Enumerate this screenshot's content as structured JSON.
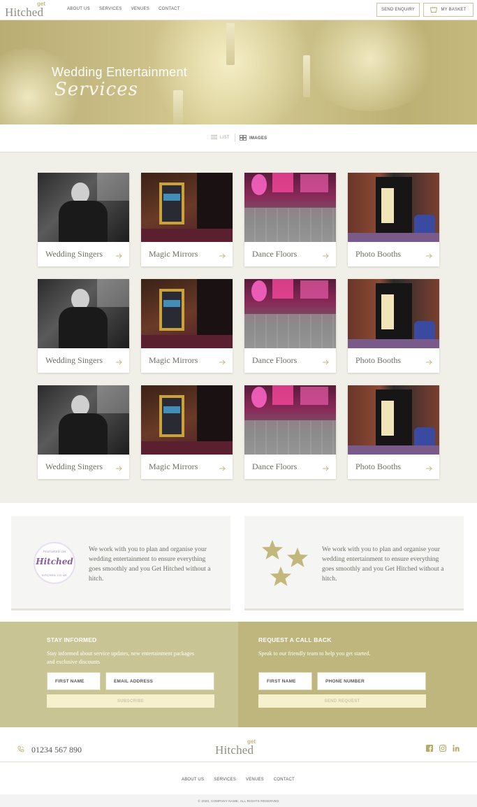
{
  "header": {
    "logo_main": "Hitched",
    "logo_get": "get",
    "nav": [
      "ABOUT US",
      "SERVICES",
      "VENUES",
      "CONTACT"
    ],
    "send_enquiry": "SEND ENQUIRY",
    "basket": "MY BASKET"
  },
  "hero": {
    "title": "Wedding Entertainment",
    "subtitle": "Services"
  },
  "view_toggle": {
    "list": "LIST",
    "images": "IMAGES",
    "active": "images"
  },
  "cards": [
    {
      "label": "Wedding Singers",
      "image": "singer-photo"
    },
    {
      "label": "Magic Mirrors",
      "image": "magic-mirror-photo"
    },
    {
      "label": "Dance Floors",
      "image": "dance-floor-photo"
    },
    {
      "label": "Photo Booths",
      "image": "photo-booth-photo"
    },
    {
      "label": "Wedding Singers",
      "image": "singer-photo"
    },
    {
      "label": "Magic Mirrors",
      "image": "magic-mirror-photo"
    },
    {
      "label": "Dance Floors",
      "image": "dance-floor-photo"
    },
    {
      "label": "Photo Booths",
      "image": "photo-booth-photo"
    },
    {
      "label": "Wedding Singers",
      "image": "singer-photo"
    },
    {
      "label": "Magic Mirrors",
      "image": "magic-mirror-photo"
    },
    {
      "label": "Dance Floors",
      "image": "dance-floor-photo"
    },
    {
      "label": "Photo Booths",
      "image": "photo-booth-photo"
    }
  ],
  "features": {
    "left": {
      "text": "We work with you to plan and organise your wedding entertainment to ensure everything goes smoothly and you Get Hitched without a hitch.",
      "badge_top": "FEATURED ON",
      "badge_main": "Hitched",
      "badge_bottom": "HITCHED.CO.UK"
    },
    "right": {
      "text": "We work with you to plan and organise your wedding entertainment to ensure everything goes smoothly and you Get Hitched without a hitch.",
      "icon": "stars-icon"
    }
  },
  "newsletter": {
    "title": "STAY INFORMED",
    "desc": "Stay informed about service updates, new entertainment packages and exclusive discounts",
    "first_name": "FIRST NAME",
    "email": "EMAIL ADDRESS",
    "submit": "SUBSCRIBE"
  },
  "callback": {
    "title": "REQUEST A CALL BACK",
    "desc": "Speak to our friendly team to help you get started.",
    "first_name": "FIRST NAME",
    "phone": "PHONE NUMBER",
    "submit": "SEND REQUEST"
  },
  "footer": {
    "phone": "01234 567 890",
    "logo_main": "Hitched",
    "logo_get": "get",
    "socials": [
      "facebook-icon",
      "instagram-icon",
      "linkedin-icon"
    ],
    "nav": [
      "ABOUT US",
      "SERVICES",
      "VENUES",
      "CONTACT"
    ],
    "copyright": "© 2020, COMPANY NAME, ALL RIGHTS RESERVED"
  },
  "colors": {
    "accent": "#c2b87c",
    "newsletter_bg": "#c9c494",
    "callback_bg": "#bfb67d",
    "grid_bg": "#f1f0e8"
  }
}
